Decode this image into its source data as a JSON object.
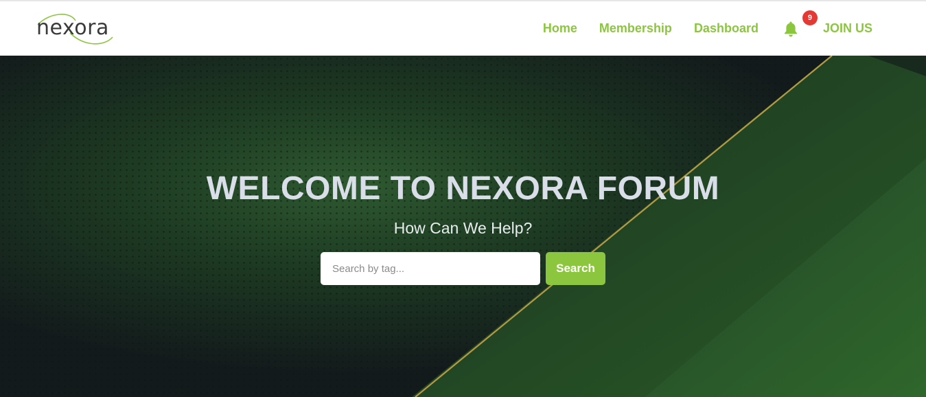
{
  "brand": {
    "logo_text": "nexora",
    "accent_color": "#8cc63f",
    "badge_color": "#e53935"
  },
  "nav": {
    "items": [
      {
        "label": "Home"
      },
      {
        "label": "Membership"
      },
      {
        "label": "Dashboard"
      }
    ],
    "notifications": {
      "icon": "bell-icon",
      "count": "9"
    },
    "join_label": "JOIN US"
  },
  "hero": {
    "title": "WELCOME TO NEXORA FORUM",
    "subtitle": "How Can We Help?",
    "search": {
      "placeholder": "Search by tag...",
      "value": "",
      "button_label": "Search"
    }
  }
}
